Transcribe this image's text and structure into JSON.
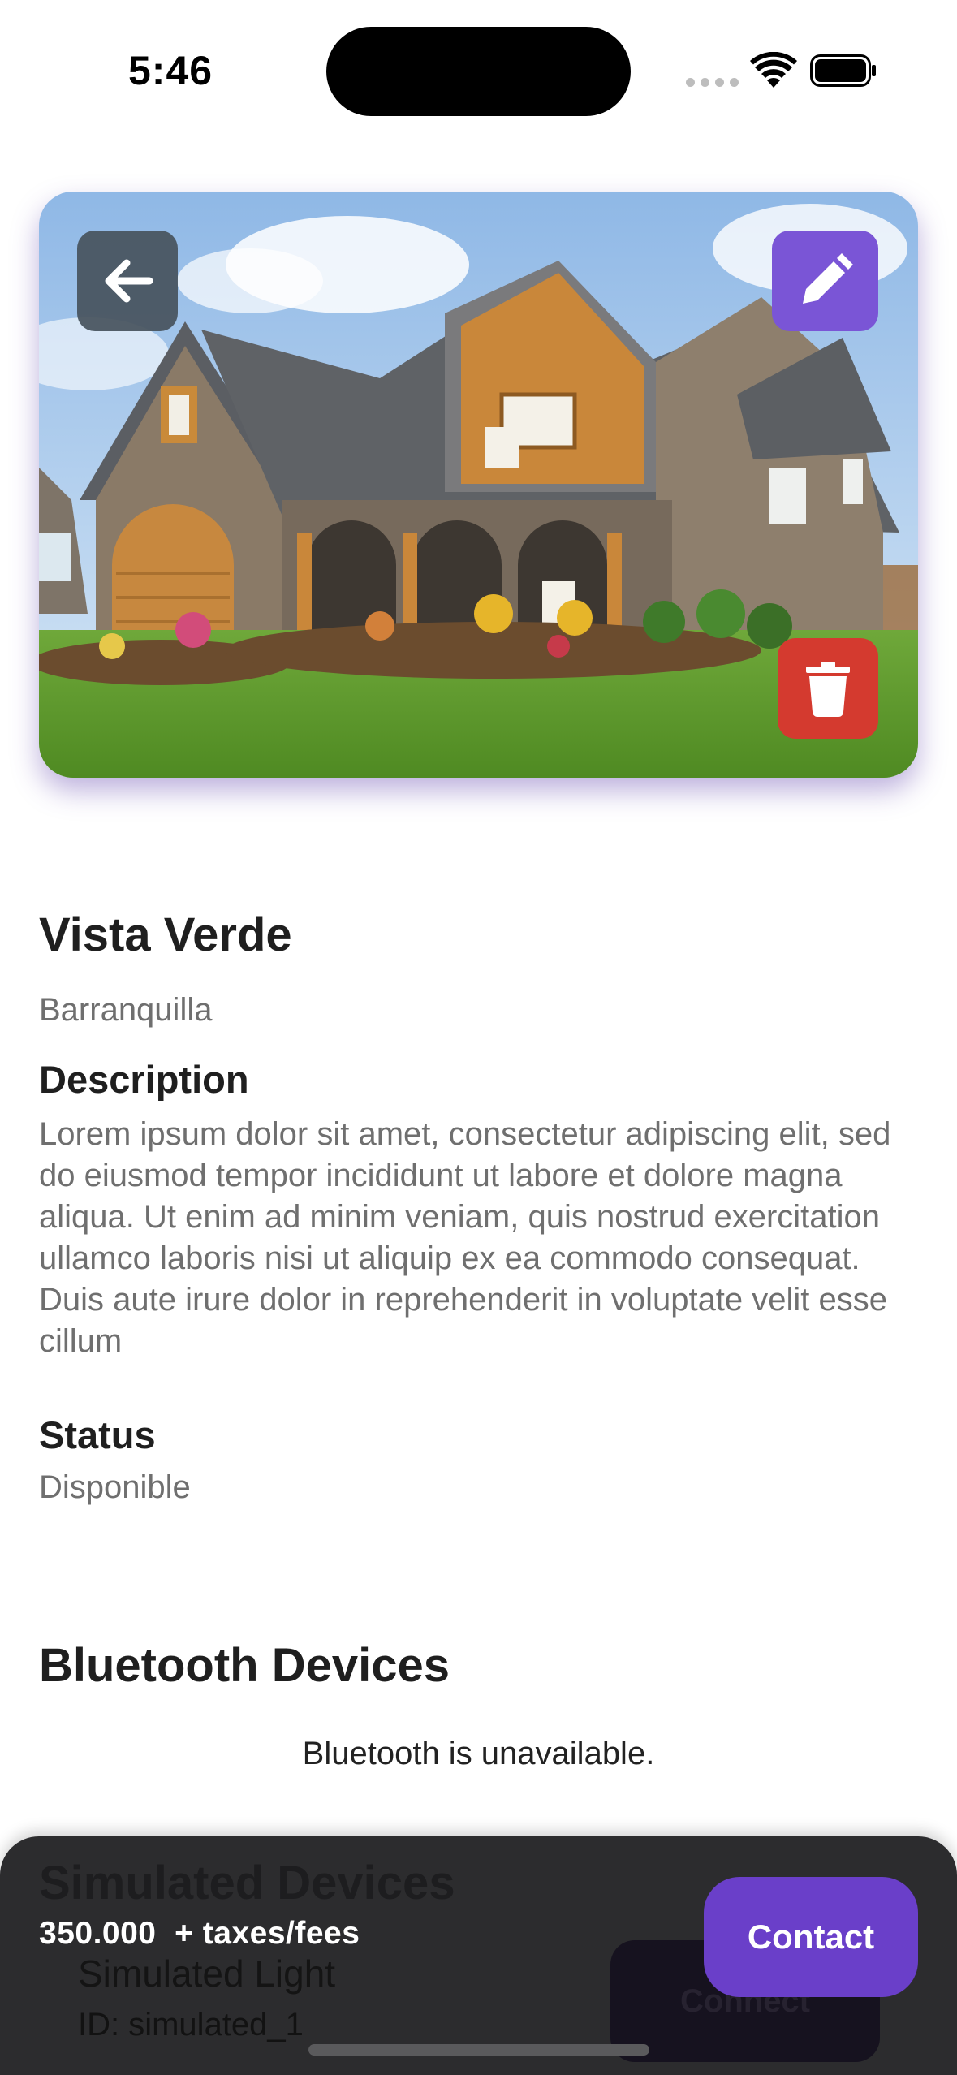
{
  "status_bar": {
    "time": "5:46"
  },
  "property": {
    "name": "Vista Verde",
    "city": "Barranquilla",
    "description_heading": "Description",
    "description": "Lorem ipsum dolor sit amet, consectetur adipiscing elit, sed do eiusmod tempor incididunt ut labore et dolore magna aliqua. Ut enim ad minim veniam, quis nostrud exercitation ullamco laboris nisi ut aliquip ex ea commodo consequat. Duis aute irure dolor in reprehenderit in voluptate velit esse cillum",
    "status_heading": "Status",
    "status": "Disponible"
  },
  "bluetooth": {
    "heading": "Bluetooth Devices",
    "message": "Bluetooth is unavailable."
  },
  "simulated": {
    "heading": "Simulated Devices",
    "device_name": "Simulated Light",
    "device_id": "ID: simulated_1",
    "connect_label": "Connect"
  },
  "footer": {
    "price": "350.000",
    "price_suffix": "+ taxes/fees",
    "contact_label": "Contact"
  },
  "icons": {
    "back": "arrow-left-icon",
    "edit": "pencil-icon",
    "delete": "trash-icon"
  },
  "colors": {
    "edit_button": "#7a55d6",
    "delete_button": "#d43a2f",
    "contact_button": "#6a3fc9",
    "bottom_bar": "#2c2c2e"
  }
}
